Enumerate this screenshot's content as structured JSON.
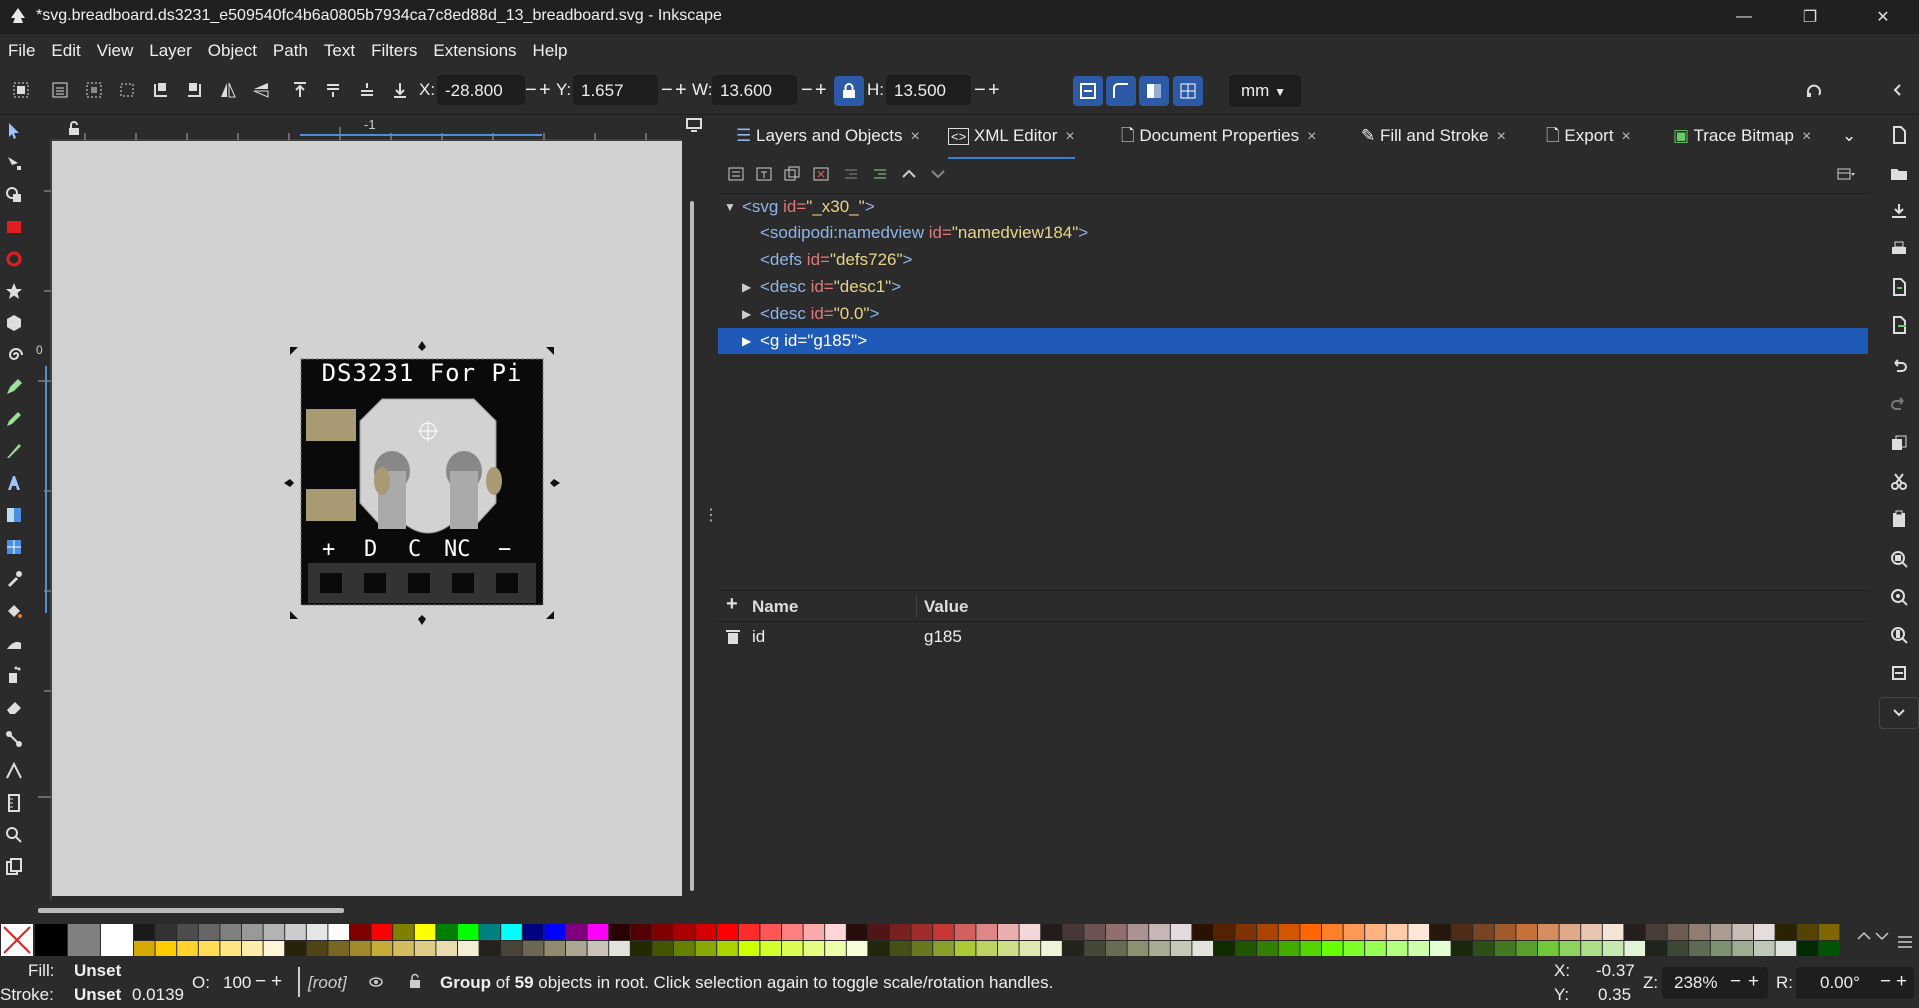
{
  "window": {
    "title": "*svg.breadboard.ds3231_e509540fc4b6a0805b7934ca7c8ed88d_13_breadboard.svg - Inkscape",
    "minimize": "—",
    "restore": "❐",
    "close": "✕"
  },
  "menu": [
    "File",
    "Edit",
    "View",
    "Layer",
    "Object",
    "Path",
    "Text",
    "Filters",
    "Extensions",
    "Help"
  ],
  "toolbar": {
    "x_label": "X:",
    "x_value": "-28.800",
    "y_label": "Y:",
    "y_value": "1.657",
    "w_label": "W:",
    "w_value": "13.600",
    "h_label": "H:",
    "h_value": "13.500",
    "unit": "mm",
    "minus": "−",
    "plus": "+"
  },
  "ruler": {
    "top_mark": "-1",
    "left_mark": "0"
  },
  "canvas": {
    "board_label_top": "DS3231 For Pi",
    "board_pins": [
      "+",
      "D",
      "C",
      "NC",
      "−"
    ]
  },
  "dock": {
    "tabs": [
      {
        "label": "Layers and Objects",
        "close": "×"
      },
      {
        "label": "XML Editor",
        "close": "×"
      },
      {
        "label": "Document Properties",
        "close": "×"
      },
      {
        "label": "Fill and Stroke",
        "close": "×"
      },
      {
        "label": "Export",
        "close": "×"
      },
      {
        "label": "Trace Bitmap",
        "close": "×"
      }
    ],
    "xml_nodes": [
      {
        "tag": "<svg",
        "attr": "id=",
        "val": "\"_x30_\"",
        "end": ">"
      },
      {
        "tag": "<sodipodi:namedview",
        "attr": "id=",
        "val": "\"namedview184\"",
        "end": ">"
      },
      {
        "tag": "<defs",
        "attr": "id=",
        "val": "\"defs726\"",
        "end": ">"
      },
      {
        "tag": "<desc",
        "attr": "id=",
        "val": "\"desc1\"",
        "end": ">"
      },
      {
        "tag": "<desc",
        "attr": "id=",
        "val": "\"0.0\"",
        "end": ">"
      },
      {
        "tag": "<g",
        "attr": "id=",
        "val": "\"g185\"",
        "end": ">"
      }
    ],
    "attributes": {
      "add": "+",
      "name_header": "Name",
      "value_header": "Value",
      "rows": [
        {
          "name": "id",
          "value": "g185"
        }
      ]
    }
  },
  "status": {
    "fill_label": "Fill:",
    "fill_value": "Unset",
    "stroke_label": "Stroke:",
    "stroke_value": "Unset",
    "stroke_width": "0.0139",
    "opacity_label": "O:",
    "opacity_value": "100",
    "layer": "[root]",
    "message_bold1": "Group",
    "message_mid": " of ",
    "message_bold2": "59",
    "message_rest": " objects in root. Click selection again to toggle scale/rotation handles.",
    "cx_label": "X:",
    "cx_value": "-0.37",
    "cy_label": "Y:",
    "cy_value": "0.35",
    "zoom_label": "Z:",
    "zoom_value": "238%",
    "rot_label": "R:",
    "rot_value": "0.00°"
  },
  "colors": {
    "selection": "#1f5ab8",
    "accent_button": "#2d5aa6",
    "board": "#0a0a0a",
    "pad": "#a89a72"
  }
}
